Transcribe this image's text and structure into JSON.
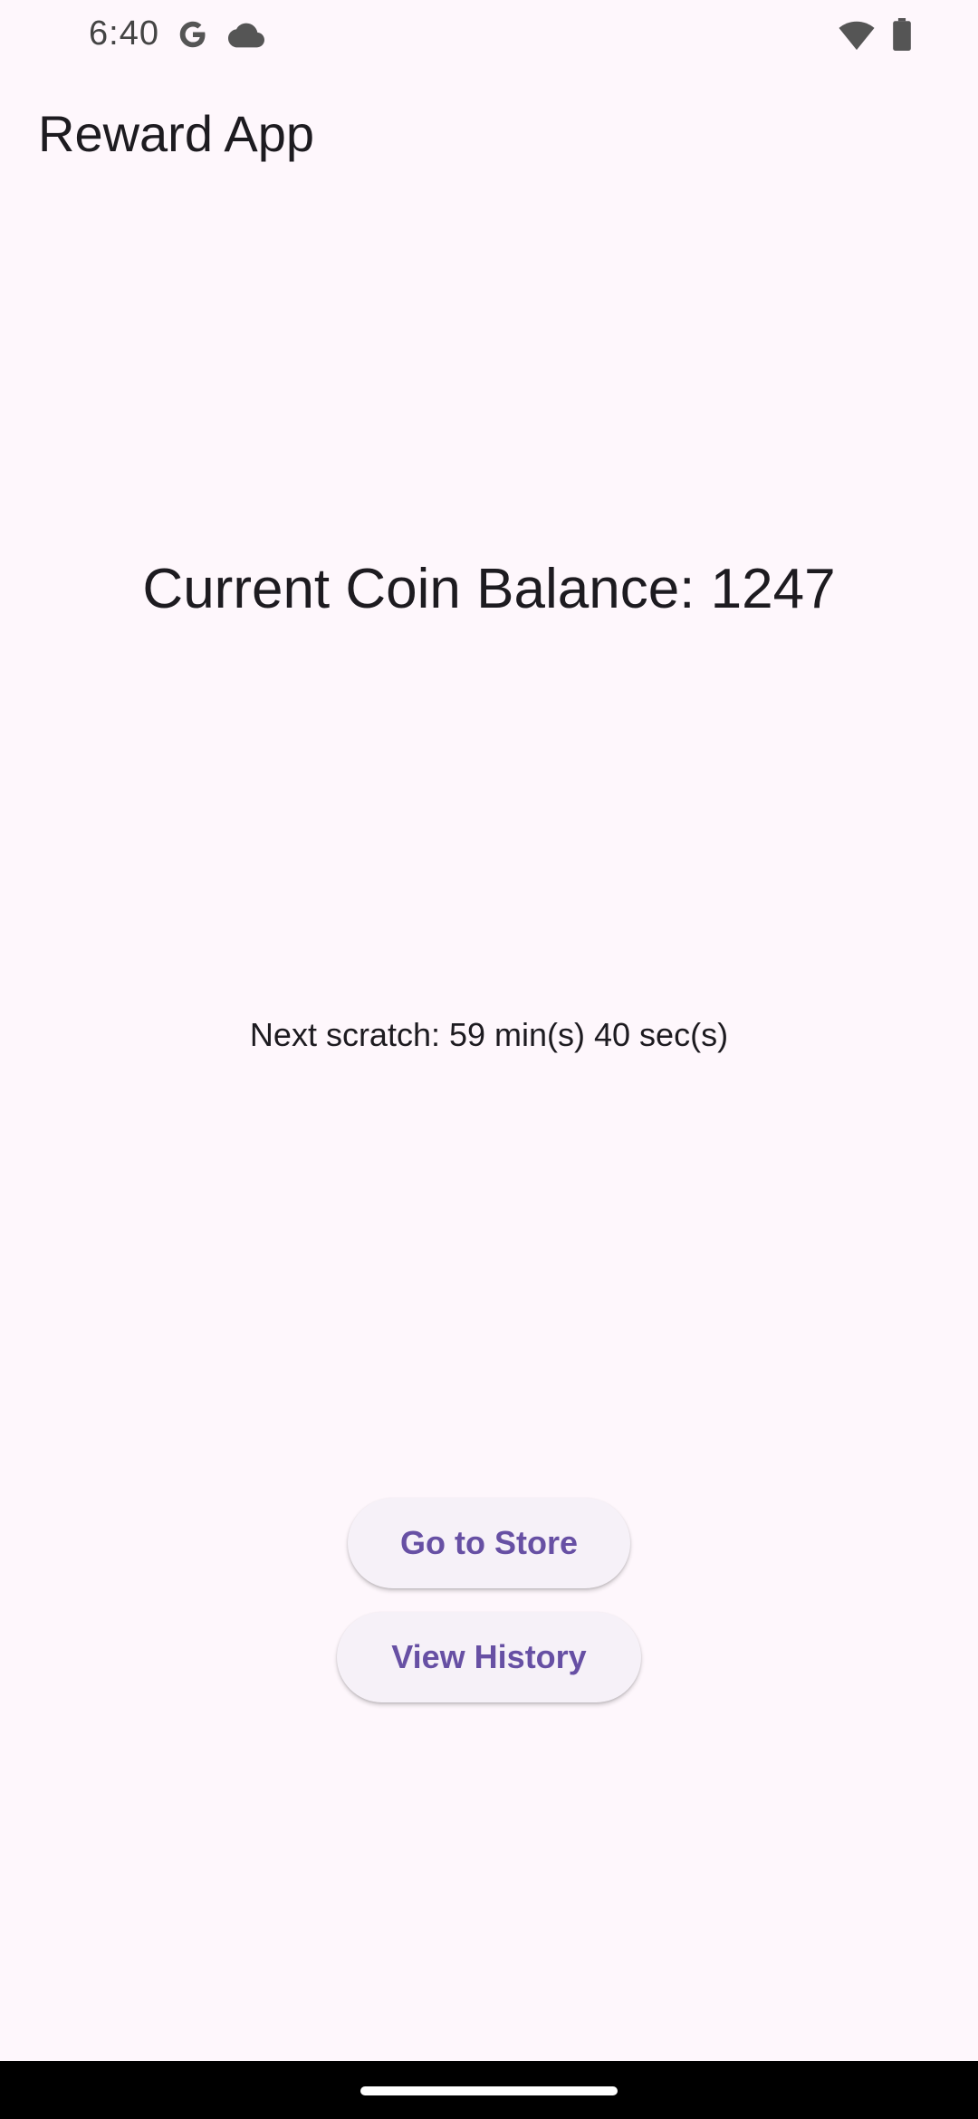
{
  "status_bar": {
    "time": "6:40",
    "icons": [
      "google-icon",
      "cloud-icon",
      "wifi-icon",
      "battery-icon"
    ]
  },
  "app_bar": {
    "title": "Reward App"
  },
  "main": {
    "balance_text": "Current Coin Balance: 1247",
    "next_scratch_text": "Next scratch: 59 min(s) 40 sec(s)"
  },
  "actions": {
    "store_label": "Go to Store",
    "history_label": "View History"
  },
  "colors": {
    "background": "#FEF7FC",
    "accent": "#6750A4",
    "button_bg": "#F6F1F8",
    "text": "#1D1B20"
  }
}
